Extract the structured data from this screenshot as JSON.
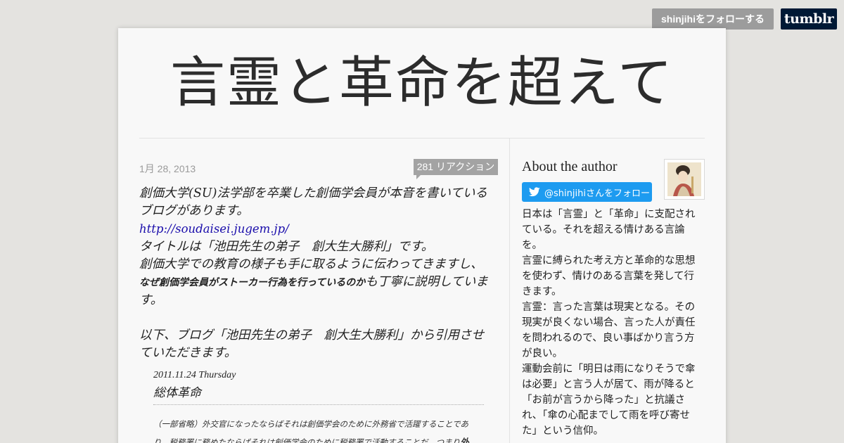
{
  "topbar": {
    "follow_label": "shinjihiをフォローする",
    "logo_text": "tumblr"
  },
  "blog": {
    "title": "言霊と革命を超えて"
  },
  "post": {
    "date": "1月 28, 2013",
    "notes": "281 リアクション",
    "paragraphs": [
      "創価大学(SU)法学部を卒業した創価学会員が本音を書いている",
      "ブログがあります。"
    ],
    "link": "http://soudaisei.jugem.jp/",
    "line3": "タイトルは「池田先生の弟子　創大生大勝利」です。",
    "line4": "創価大学での教育の様子も手に取るように伝わってきますし、",
    "line5_bold": "なぜ創価学会員がストーカー行為を行っているのか",
    "line5_rest": "も丁寧に説明していま",
    "line6": "す。",
    "line7": "以下、ブログ「池田先生の弟子　創大生大勝利」から引用させ",
    "line8": "ていただきます。"
  },
  "quote": {
    "date": "2011.11.24 Thursday",
    "title": "総体革命",
    "line1": "（一部省略）外交官になったならばそれは創価学会のために外務省で活躍することであ",
    "line2_plain": "り、税務署に務めたならばそれは創価学会のために税務署で活動することだ。つまり",
    "line2_bold": "外"
  },
  "sidebar": {
    "about_title": "About the author",
    "twitter_label": "@shinjihiさんをフォロー",
    "about_lines": [
      "日本は「言霊」と「革命」に支配され",
      "ている。それを超える情けある言論",
      "を。",
      "言霊に縛られた考え方と革命的な思想",
      "を使わず、情けのある言葉を発して行",
      "きます。",
      "言霊：言った言葉は現実となる。その",
      "現実が良くない場合、言った人が責任",
      "を問われるので、良い事ばかり言う方",
      "が良い。",
      "運動会前に「明日は雨になりそうで傘",
      "は必要」と言う人が居て、雨が降ると",
      "「お前が言うから降った」と抗議さ",
      "れ、「傘の心配までして雨を呼び寄せ",
      "た」という信仰。"
    ]
  },
  "colors": {
    "background": "#e4e3e0",
    "card": "#f8f8f8",
    "twitter_blue": "#1d9bf0",
    "tumblr_navy": "#001935",
    "link": "#1a0dab"
  },
  "icons": [
    "tumblr-logo-icon",
    "twitter-bird-icon",
    "notes-tail-icon"
  ]
}
